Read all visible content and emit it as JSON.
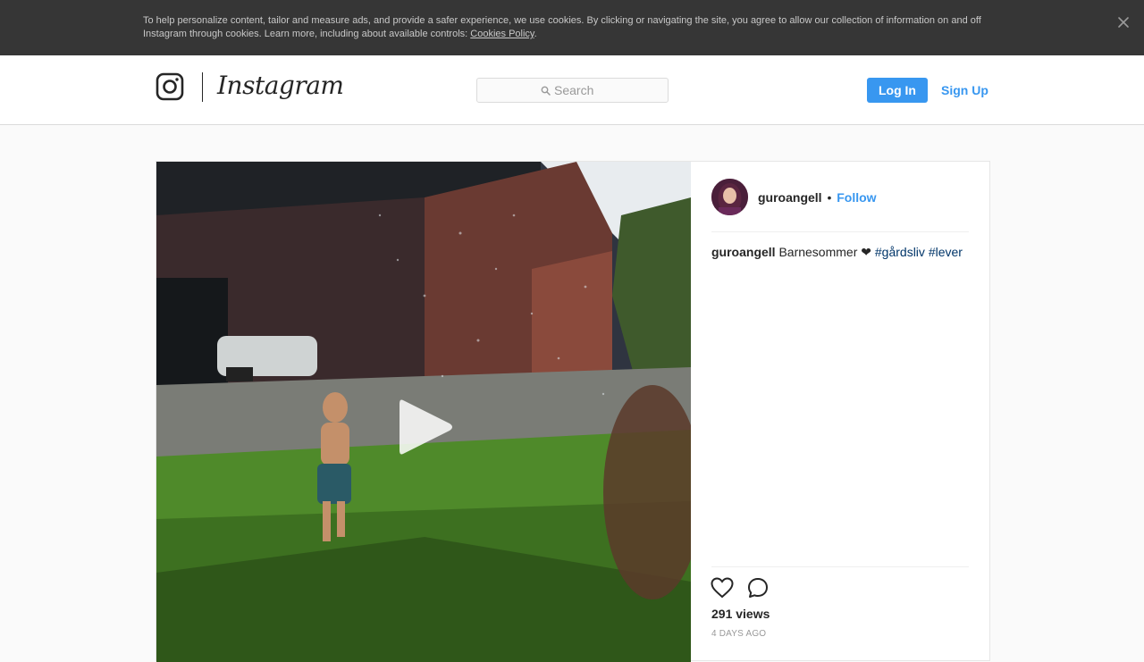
{
  "cookie_banner": {
    "text": "To help personalize content, tailor and measure ads, and provide a safer experience, we use cookies. By clicking or navigating the site, you agree to allow our collection of information on and off Instagram through cookies. Learn more, including about available controls: ",
    "link_text": "Cookies Policy",
    "suffix": ".",
    "close_icon": "close-icon"
  },
  "header": {
    "logo_text": "Instagram",
    "search_placeholder": "Search",
    "login_label": "Log In",
    "signup_label": "Sign Up"
  },
  "post": {
    "owner": "guroangell",
    "separator": "•",
    "follow_label": "Follow",
    "caption": {
      "user": "guroangell",
      "text": " Barnesommer ❤ ",
      "tags": [
        "#gårdsliv",
        "#lever"
      ]
    },
    "views": "291 views",
    "time": "4 DAYS AGO"
  },
  "colors": {
    "accent": "#3897f0",
    "banner": "#363636",
    "hashtag": "#003569"
  }
}
